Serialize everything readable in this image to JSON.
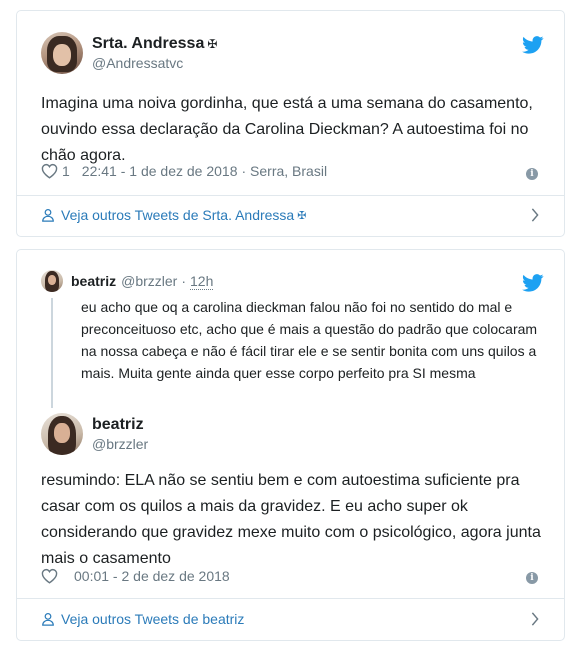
{
  "tweet1": {
    "display_name": "Srta. Andressa",
    "name_symbol": "✠",
    "handle": "@Andressatvc",
    "text": "Imagina uma noiva gordinha, que está a uma semana do casamento, ouvindo essa declaração da Carolina Dieckman? A autoestima foi no chão agora.",
    "likes": "1",
    "timestamp": "22:41 - 1 de dez de 2018",
    "location": "· Serra, Brasil",
    "footer_link": "Veja outros Tweets de Srta. Andressa",
    "icons": {
      "bird": "twitter-bird-icon",
      "heart": "heart-icon",
      "info": "info-icon",
      "person": "person-icon",
      "chevron": "chevron-right-icon"
    }
  },
  "tweet2": {
    "quoted": {
      "display_name": "beatriz",
      "handle": "@brzzler",
      "dot": "·",
      "time": "12h",
      "text": "eu acho que oq a carolina dieckman falou não foi no sentido do mal e preconceituoso etc, acho que é mais a questão do padrão que colocaram na nossa cabeça e não é fácil tirar ele e se sentir bonita com uns quilos a mais. Muita gente ainda quer esse corpo perfeito pra SI mesma"
    },
    "display_name": "beatriz",
    "handle": "@brzzler",
    "text": "resumindo: ELA não se sentiu bem e com autoestima suficiente pra casar com os quilos a mais da gravidez. E eu acho super ok considerando que gravidez mexe muito com o psicológico, agora junta mais o casamento",
    "timestamp": "00:01 - 2 de dez de 2018",
    "footer_link": "Veja outros Tweets de beatriz"
  },
  "colors": {
    "twitter_blue": "#1da1f2",
    "link_blue": "#2b7bb9",
    "muted": "#697882",
    "border": "#e1e8ed"
  }
}
